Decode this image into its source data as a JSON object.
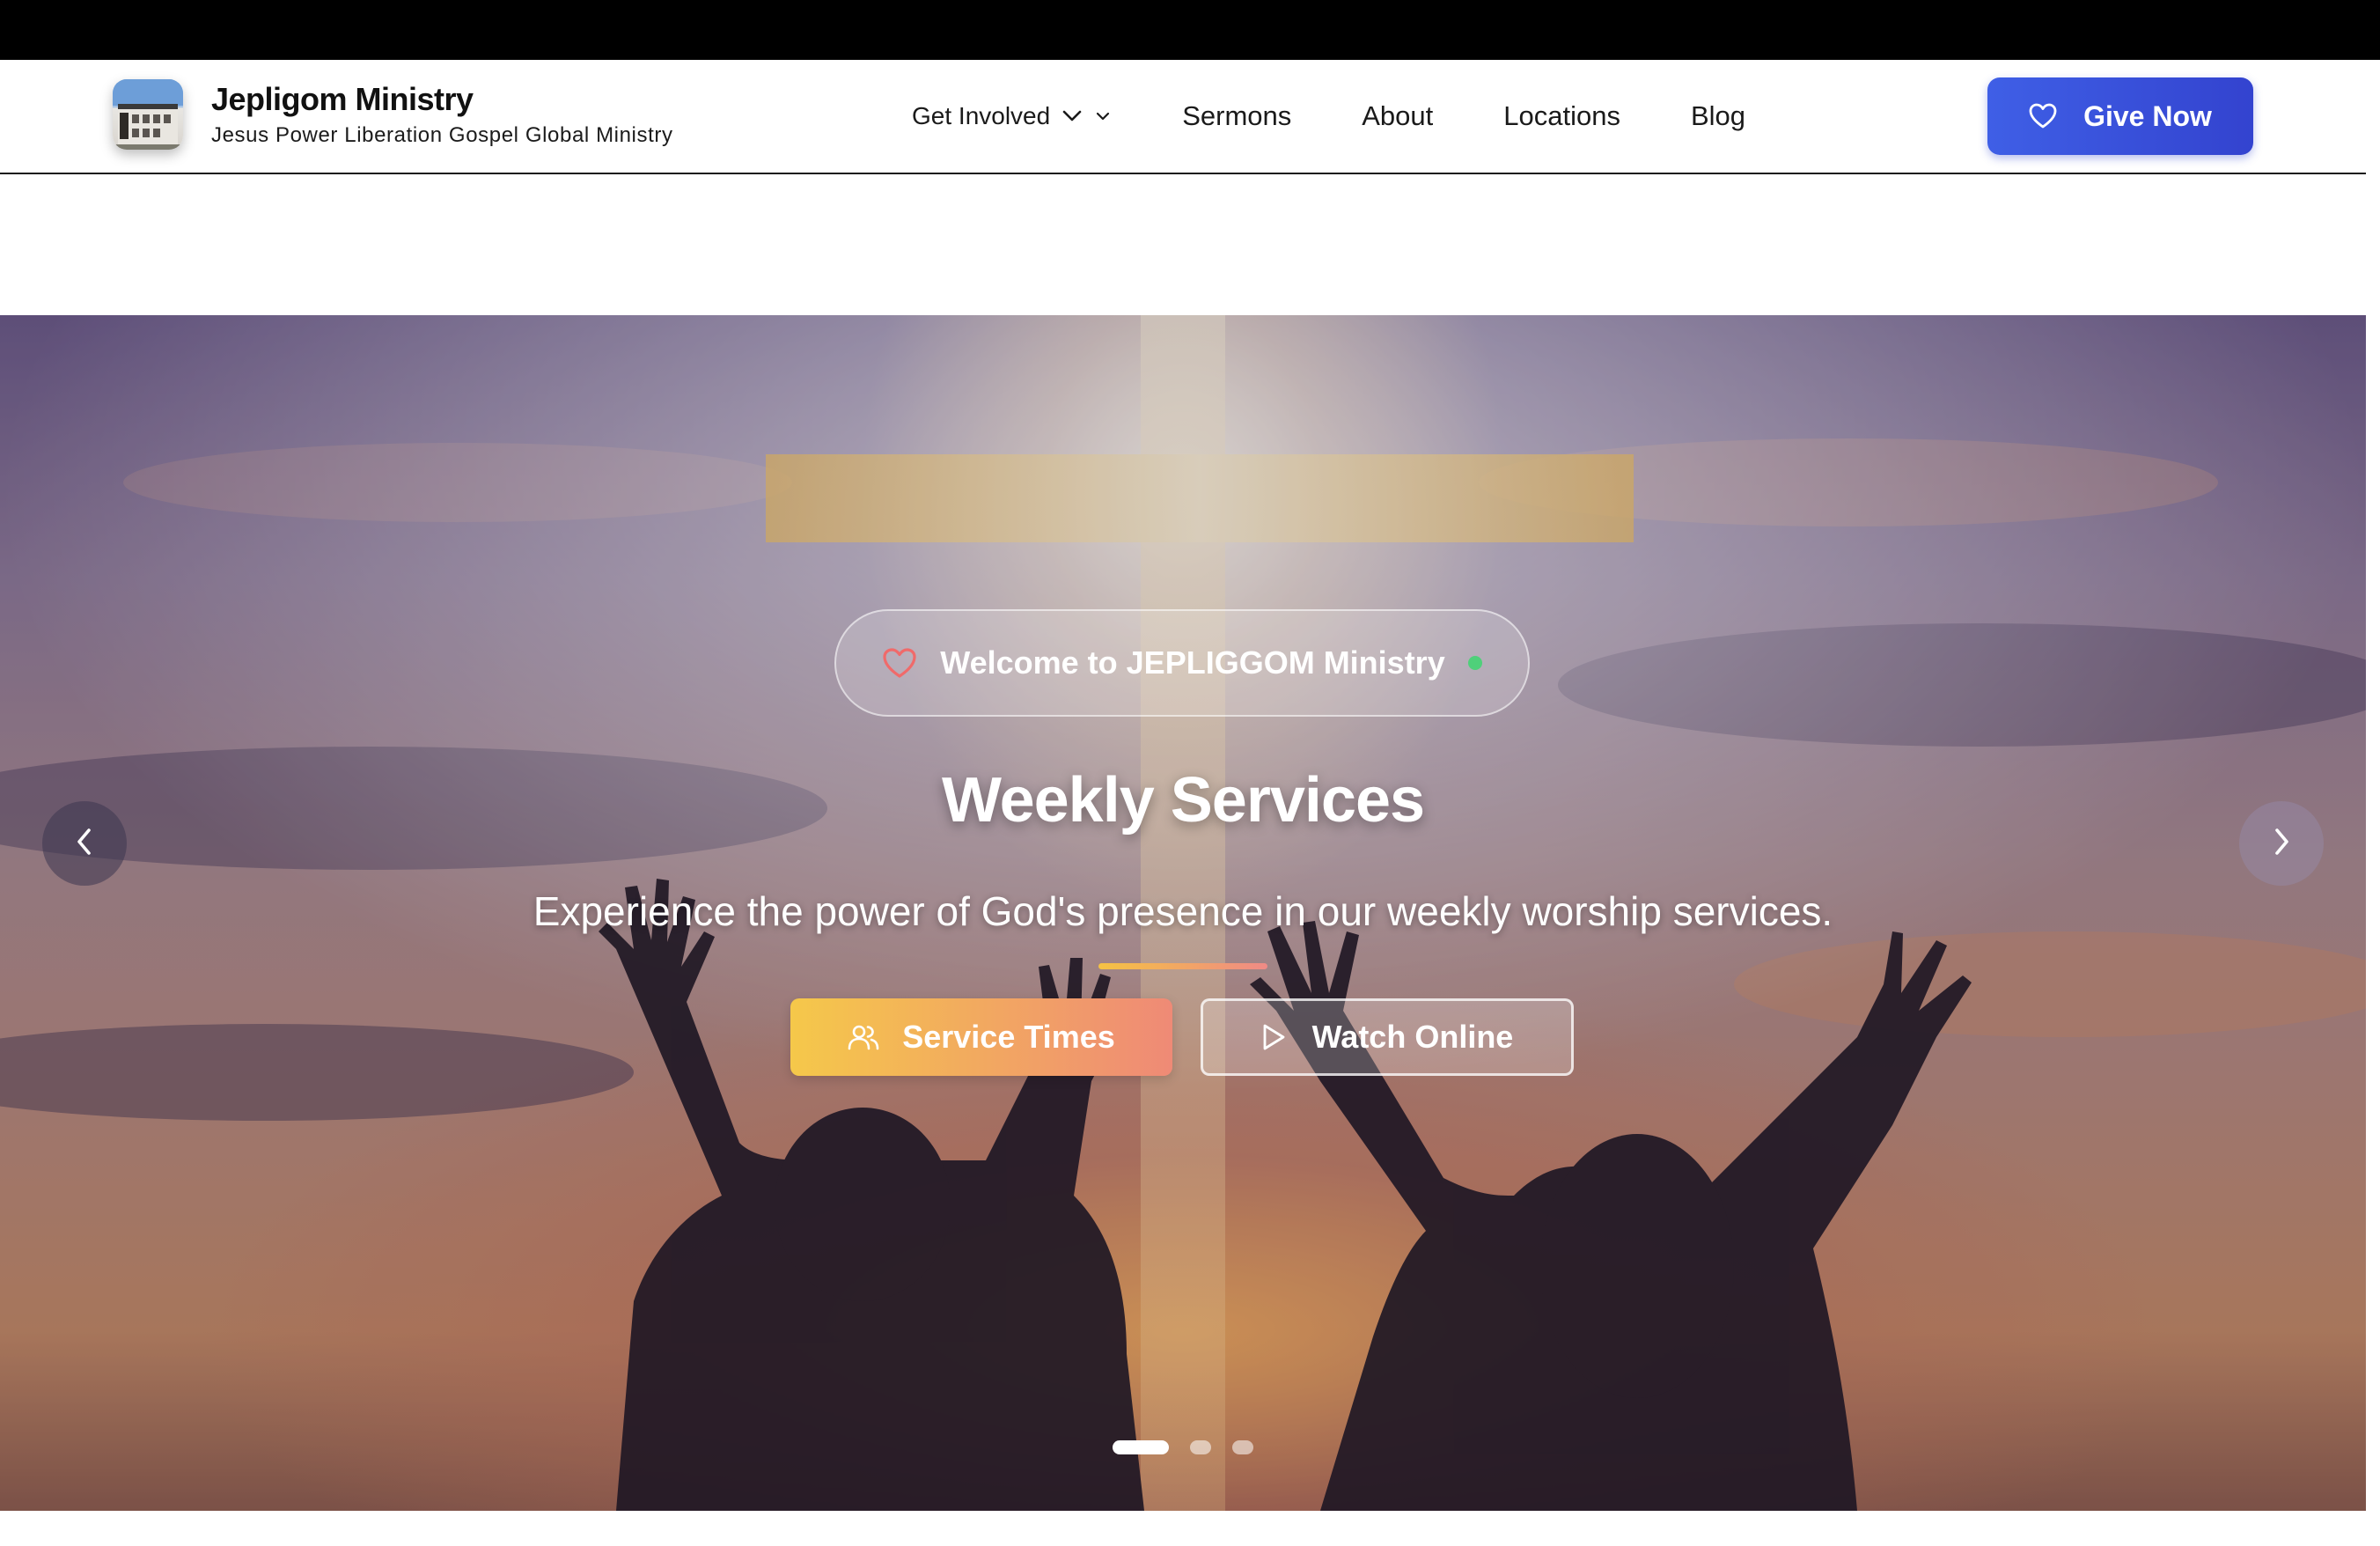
{
  "brand": {
    "title": "Jepligom Ministry",
    "subtitle": "Jesus Power Liberation Gospel Global Ministry",
    "logo_icon": "church-building-logo"
  },
  "nav": {
    "items": [
      {
        "label": "Get Involved",
        "has_dropdown": true
      },
      {
        "label": "Sermons"
      },
      {
        "label": "About"
      },
      {
        "label": "Locations"
      },
      {
        "label": "Blog"
      }
    ],
    "give_button": {
      "label": "Give Now",
      "icon": "heart-icon"
    }
  },
  "hero": {
    "welcome": "Welcome to JEPLIGGOM Ministry",
    "title": "Weekly Services",
    "subtitle": "Experience the power of God's presence in our weekly worship services.",
    "primary_button": {
      "label": "Service Times",
      "icon": "users-icon"
    },
    "secondary_button": {
      "label": "Watch Online",
      "icon": "play-icon"
    },
    "slides_total": 3,
    "active_slide": 1
  },
  "colors": {
    "accent": "#3b52dc",
    "service_gradient_start": "#f5c84a",
    "service_gradient_end": "#ef8a76",
    "live_dot": "#4fd07a"
  }
}
